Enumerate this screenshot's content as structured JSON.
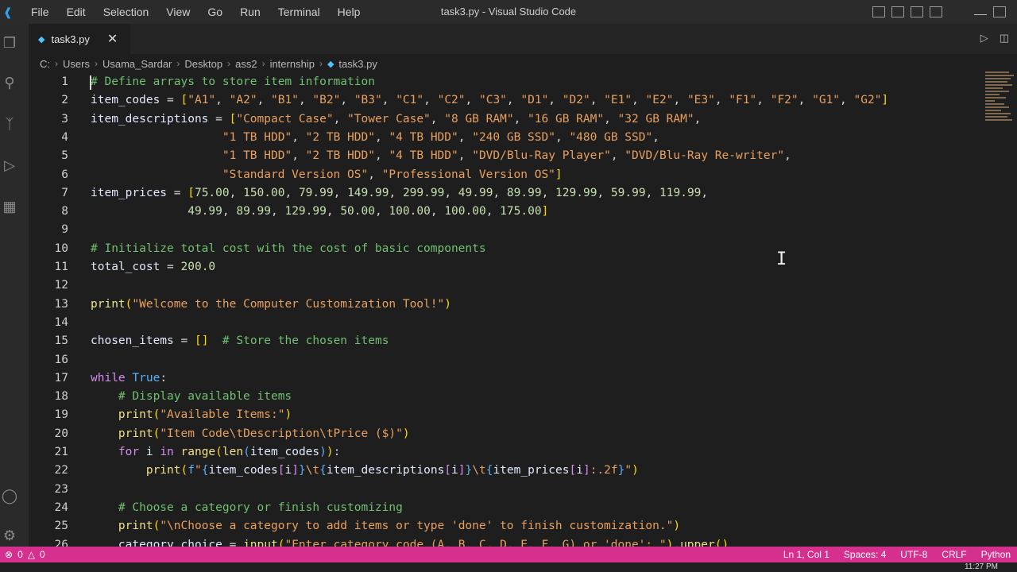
{
  "app": {
    "window_title": "task3.py - Visual Studio Code",
    "menu": [
      "File",
      "Edit",
      "Selection",
      "View",
      "Go",
      "Run",
      "Terminal",
      "Help"
    ]
  },
  "tab": {
    "name": "task3.py"
  },
  "breadcrumb": [
    "C:",
    "Users",
    "Usama_Sardar",
    "Desktop",
    "ass2",
    "internship",
    "task3.py"
  ],
  "code_lines": [
    {
      "n": "1",
      "t": [
        [
          "c-com",
          "# Define arrays to store item information"
        ]
      ]
    },
    {
      "n": "2",
      "t": [
        [
          "c-var",
          "item_codes"
        ],
        [
          "c-pu",
          " = "
        ],
        [
          "c-br",
          "["
        ],
        [
          "c-str",
          "\"A1\""
        ],
        [
          "c-pu",
          ", "
        ],
        [
          "c-str",
          "\"A2\""
        ],
        [
          "c-pu",
          ", "
        ],
        [
          "c-str",
          "\"B1\""
        ],
        [
          "c-pu",
          ", "
        ],
        [
          "c-str",
          "\"B2\""
        ],
        [
          "c-pu",
          ", "
        ],
        [
          "c-str",
          "\"B3\""
        ],
        [
          "c-pu",
          ", "
        ],
        [
          "c-str",
          "\"C1\""
        ],
        [
          "c-pu",
          ", "
        ],
        [
          "c-str",
          "\"C2\""
        ],
        [
          "c-pu",
          ", "
        ],
        [
          "c-str",
          "\"C3\""
        ],
        [
          "c-pu",
          ", "
        ],
        [
          "c-str",
          "\"D1\""
        ],
        [
          "c-pu",
          ", "
        ],
        [
          "c-str",
          "\"D2\""
        ],
        [
          "c-pu",
          ", "
        ],
        [
          "c-str",
          "\"E1\""
        ],
        [
          "c-pu",
          ", "
        ],
        [
          "c-str",
          "\"E2\""
        ],
        [
          "c-pu",
          ", "
        ],
        [
          "c-str",
          "\"E3\""
        ],
        [
          "c-pu",
          ", "
        ],
        [
          "c-str",
          "\"F1\""
        ],
        [
          "c-pu",
          ", "
        ],
        [
          "c-str",
          "\"F2\""
        ],
        [
          "c-pu",
          ", "
        ],
        [
          "c-str",
          "\"G1\""
        ],
        [
          "c-pu",
          ", "
        ],
        [
          "c-str",
          "\"G2\""
        ],
        [
          "c-br",
          "]"
        ]
      ]
    },
    {
      "n": "3",
      "t": [
        [
          "c-var",
          "item_descriptions"
        ],
        [
          "c-pu",
          " = "
        ],
        [
          "c-br",
          "["
        ],
        [
          "c-str",
          "\"Compact Case\""
        ],
        [
          "c-pu",
          ", "
        ],
        [
          "c-str",
          "\"Tower Case\""
        ],
        [
          "c-pu",
          ", "
        ],
        [
          "c-str",
          "\"8 GB RAM\""
        ],
        [
          "c-pu",
          ", "
        ],
        [
          "c-str",
          "\"16 GB RAM\""
        ],
        [
          "c-pu",
          ", "
        ],
        [
          "c-str",
          "\"32 GB RAM\""
        ],
        [
          "c-pu",
          ","
        ]
      ]
    },
    {
      "n": "4",
      "t": [
        [
          "c-pu",
          "                   "
        ],
        [
          "c-str",
          "\"1 TB HDD\""
        ],
        [
          "c-pu",
          ", "
        ],
        [
          "c-str",
          "\"2 TB HDD\""
        ],
        [
          "c-pu",
          ", "
        ],
        [
          "c-str",
          "\"4 TB HDD\""
        ],
        [
          "c-pu",
          ", "
        ],
        [
          "c-str",
          "\"240 GB SSD\""
        ],
        [
          "c-pu",
          ", "
        ],
        [
          "c-str",
          "\"480 GB SSD\""
        ],
        [
          "c-pu",
          ","
        ]
      ]
    },
    {
      "n": "5",
      "t": [
        [
          "c-pu",
          "                   "
        ],
        [
          "c-str",
          "\"1 TB HDD\""
        ],
        [
          "c-pu",
          ", "
        ],
        [
          "c-str",
          "\"2 TB HDD\""
        ],
        [
          "c-pu",
          ", "
        ],
        [
          "c-str",
          "\"4 TB HDD\""
        ],
        [
          "c-pu",
          ", "
        ],
        [
          "c-str",
          "\"DVD/Blu-Ray Player\""
        ],
        [
          "c-pu",
          ", "
        ],
        [
          "c-str",
          "\"DVD/Blu-Ray Re-writer\""
        ],
        [
          "c-pu",
          ","
        ]
      ]
    },
    {
      "n": "6",
      "t": [
        [
          "c-pu",
          "                   "
        ],
        [
          "c-str",
          "\"Standard Version OS\""
        ],
        [
          "c-pu",
          ", "
        ],
        [
          "c-str",
          "\"Professional Version OS\""
        ],
        [
          "c-br",
          "]"
        ]
      ]
    },
    {
      "n": "7",
      "t": [
        [
          "c-var",
          "item_prices"
        ],
        [
          "c-pu",
          " = "
        ],
        [
          "c-br",
          "["
        ],
        [
          "c-num",
          "75.00"
        ],
        [
          "c-pu",
          ", "
        ],
        [
          "c-num",
          "150.00"
        ],
        [
          "c-pu",
          ", "
        ],
        [
          "c-num",
          "79.99"
        ],
        [
          "c-pu",
          ", "
        ],
        [
          "c-num",
          "149.99"
        ],
        [
          "c-pu",
          ", "
        ],
        [
          "c-num",
          "299.99"
        ],
        [
          "c-pu",
          ", "
        ],
        [
          "c-num",
          "49.99"
        ],
        [
          "c-pu",
          ", "
        ],
        [
          "c-num",
          "89.99"
        ],
        [
          "c-pu",
          ", "
        ],
        [
          "c-num",
          "129.99"
        ],
        [
          "c-pu",
          ", "
        ],
        [
          "c-num",
          "59.99"
        ],
        [
          "c-pu",
          ", "
        ],
        [
          "c-num",
          "119.99"
        ],
        [
          "c-pu",
          ","
        ]
      ]
    },
    {
      "n": "8",
      "t": [
        [
          "c-pu",
          "              "
        ],
        [
          "c-num",
          "49.99"
        ],
        [
          "c-pu",
          ", "
        ],
        [
          "c-num",
          "89.99"
        ],
        [
          "c-pu",
          ", "
        ],
        [
          "c-num",
          "129.99"
        ],
        [
          "c-pu",
          ", "
        ],
        [
          "c-num",
          "50.00"
        ],
        [
          "c-pu",
          ", "
        ],
        [
          "c-num",
          "100.00"
        ],
        [
          "c-pu",
          ", "
        ],
        [
          "c-num",
          "100.00"
        ],
        [
          "c-pu",
          ", "
        ],
        [
          "c-num",
          "175.00"
        ],
        [
          "c-br",
          "]"
        ]
      ]
    },
    {
      "n": "9",
      "t": []
    },
    {
      "n": "10",
      "t": [
        [
          "c-com",
          "# Initialize total cost with the cost of basic components"
        ]
      ]
    },
    {
      "n": "11",
      "t": [
        [
          "c-var",
          "total_cost"
        ],
        [
          "c-pu",
          " = "
        ],
        [
          "c-num",
          "200.0"
        ]
      ]
    },
    {
      "n": "12",
      "t": []
    },
    {
      "n": "13",
      "t": [
        [
          "c-fn",
          "print"
        ],
        [
          "c-br",
          "("
        ],
        [
          "c-str",
          "\"Welcome to the Computer Customization Tool!\""
        ],
        [
          "c-br",
          ")"
        ]
      ]
    },
    {
      "n": "14",
      "t": []
    },
    {
      "n": "15",
      "t": [
        [
          "c-var",
          "chosen_items"
        ],
        [
          "c-pu",
          " = "
        ],
        [
          "c-br",
          "[]"
        ],
        [
          "c-pu",
          "  "
        ],
        [
          "c-com",
          "# Store the chosen items"
        ]
      ]
    },
    {
      "n": "16",
      "t": []
    },
    {
      "n": "17",
      "t": [
        [
          "c-kw",
          "while "
        ],
        [
          "c-bl",
          "True"
        ],
        [
          "c-pu",
          ":"
        ]
      ]
    },
    {
      "n": "18",
      "t": [
        [
          "c-pu",
          "    "
        ],
        [
          "c-com",
          "# Display available items"
        ]
      ]
    },
    {
      "n": "19",
      "t": [
        [
          "c-pu",
          "    "
        ],
        [
          "c-fn",
          "print"
        ],
        [
          "c-br",
          "("
        ],
        [
          "c-str",
          "\"Available Items:\""
        ],
        [
          "c-br",
          ")"
        ]
      ]
    },
    {
      "n": "20",
      "t": [
        [
          "c-pu",
          "    "
        ],
        [
          "c-fn",
          "print"
        ],
        [
          "c-br",
          "("
        ],
        [
          "c-str",
          "\"Item Code\\tDescription\\tPrice ($)\""
        ],
        [
          "c-br",
          ")"
        ]
      ]
    },
    {
      "n": "21",
      "t": [
        [
          "c-pu",
          "    "
        ],
        [
          "c-kw",
          "for "
        ],
        [
          "c-var",
          "i "
        ],
        [
          "c-kw",
          "in "
        ],
        [
          "c-fn",
          "range"
        ],
        [
          "c-br",
          "("
        ],
        [
          "c-fn",
          "len"
        ],
        [
          "c-bl",
          "("
        ],
        [
          "c-var",
          "item_codes"
        ],
        [
          "c-bl",
          ")"
        ],
        [
          "c-br",
          ")"
        ],
        [
          "c-pu",
          ":"
        ]
      ]
    },
    {
      "n": "22",
      "t": [
        [
          "c-pu",
          "        "
        ],
        [
          "c-fn",
          "print"
        ],
        [
          "c-br",
          "("
        ],
        [
          "c-bl",
          "f"
        ],
        [
          "c-str",
          "\""
        ],
        [
          "c-bl",
          "{"
        ],
        [
          "c-var",
          "item_codes"
        ],
        [
          "c-kw",
          "["
        ],
        [
          "c-var",
          "i"
        ],
        [
          "c-kw",
          "]"
        ],
        [
          "c-bl",
          "}"
        ],
        [
          "c-str",
          "\\t"
        ],
        [
          "c-bl",
          "{"
        ],
        [
          "c-var",
          "item_descriptions"
        ],
        [
          "c-kw",
          "["
        ],
        [
          "c-var",
          "i"
        ],
        [
          "c-kw",
          "]"
        ],
        [
          "c-bl",
          "}"
        ],
        [
          "c-str",
          "\\t"
        ],
        [
          "c-bl",
          "{"
        ],
        [
          "c-var",
          "item_prices"
        ],
        [
          "c-kw",
          "["
        ],
        [
          "c-var",
          "i"
        ],
        [
          "c-kw",
          "]"
        ],
        [
          "c-str",
          ":.2f"
        ],
        [
          "c-bl",
          "}"
        ],
        [
          "c-str",
          "\""
        ],
        [
          "c-br",
          ")"
        ]
      ]
    },
    {
      "n": "23",
      "t": []
    },
    {
      "n": "24",
      "t": [
        [
          "c-pu",
          "    "
        ],
        [
          "c-com",
          "# Choose a category or finish customizing"
        ]
      ]
    },
    {
      "n": "25",
      "t": [
        [
          "c-pu",
          "    "
        ],
        [
          "c-fn",
          "print"
        ],
        [
          "c-br",
          "("
        ],
        [
          "c-str",
          "\"\\nChoose a category to add items or type 'done' to finish customization.\""
        ],
        [
          "c-br",
          ")"
        ]
      ]
    },
    {
      "n": "26",
      "t": [
        [
          "c-pu",
          "    "
        ],
        [
          "c-var",
          "category_choice"
        ],
        [
          "c-pu",
          " = "
        ],
        [
          "c-fn",
          "input"
        ],
        [
          "c-br",
          "("
        ],
        [
          "c-str",
          "\"Enter category code (A, B, C, D, E, F, G) or 'done': \""
        ],
        [
          "c-br",
          ")"
        ],
        [
          "c-pu",
          "."
        ],
        [
          "c-fn",
          "upper"
        ],
        [
          "c-br",
          "()"
        ]
      ]
    }
  ],
  "status": {
    "errors": "0",
    "warnings": "0",
    "position": "Ln 1, Col 1",
    "spaces": "Spaces: 4",
    "encoding": "UTF-8",
    "eol": "CRLF",
    "language": "Python"
  },
  "clock": "11:27 PM",
  "colors": {
    "statusbar": "#d6308e",
    "titlebar": "#2b2b2b",
    "editor_bg": "#1e1e1e"
  }
}
